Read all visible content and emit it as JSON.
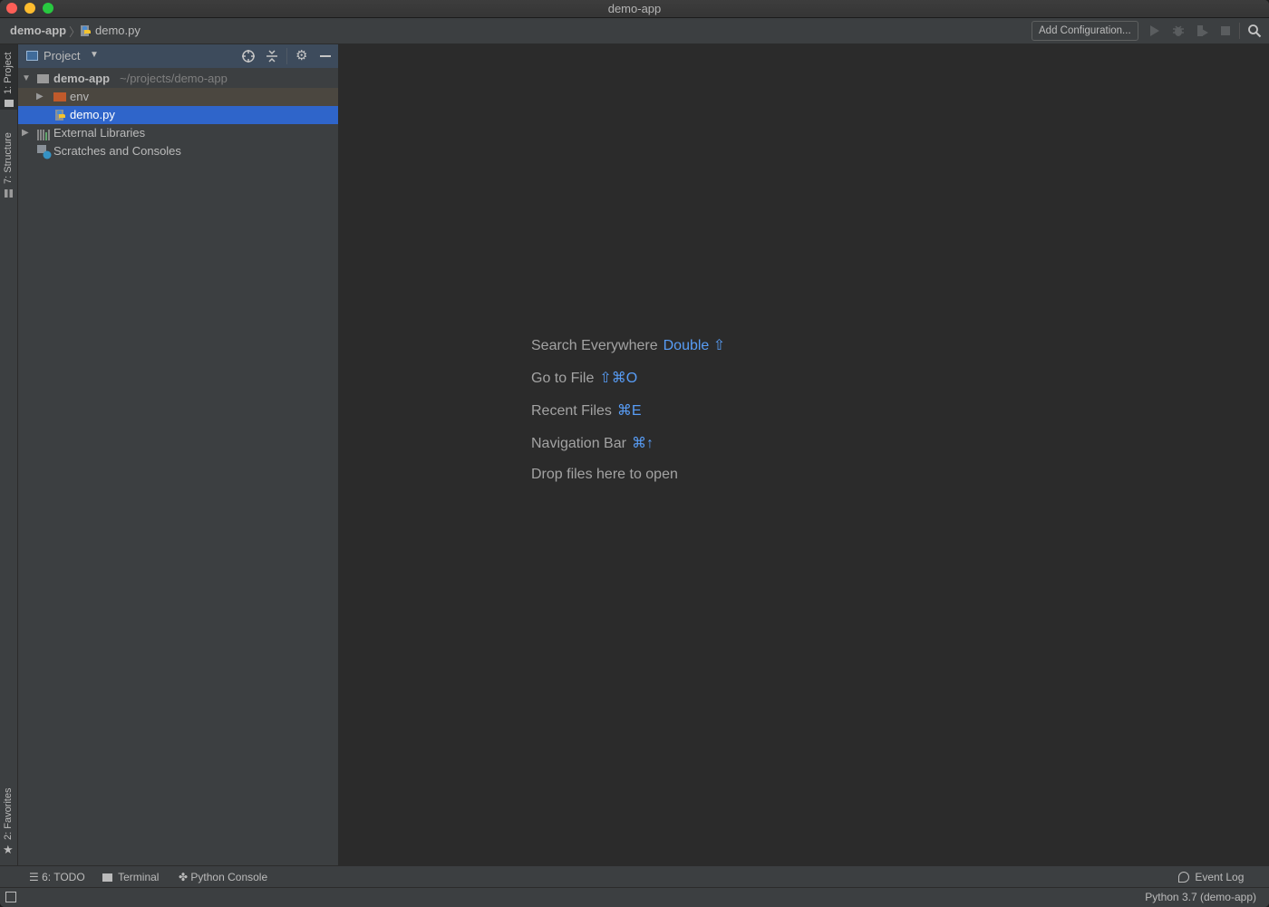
{
  "window": {
    "title": "demo-app"
  },
  "navbar": {
    "breadcrumb": [
      "demo-app",
      "demo.py"
    ],
    "add_config_label": "Add Configuration...",
    "icons": [
      "run-icon",
      "debug-icon",
      "coverage-icon",
      "stop-icon",
      "search-icon"
    ]
  },
  "left_strip": {
    "tabs": [
      "1: Project",
      "7: Structure",
      "2: Favorites"
    ]
  },
  "project_panel": {
    "title": "Project",
    "tree": [
      {
        "label": "demo-app",
        "hint": "~/projects/demo-app",
        "icon": "folder-icon",
        "expanded": true
      },
      {
        "label": "env",
        "icon": "folder-excluded-icon",
        "expanded": false
      },
      {
        "label": "demo.py",
        "icon": "python-file-icon",
        "selected": true
      },
      {
        "label": "External Libraries",
        "icon": "libraries-icon",
        "expanded": false
      },
      {
        "label": "Scratches and Consoles",
        "icon": "scratches-icon"
      }
    ]
  },
  "editor": {
    "hints": [
      {
        "label": "Search Everywhere",
        "shortcut": "Double ⇧"
      },
      {
        "label": "Go to File",
        "shortcut": "⇧⌘O"
      },
      {
        "label": "Recent Files",
        "shortcut": "⌘E"
      },
      {
        "label": "Navigation Bar",
        "shortcut": "⌘↑"
      },
      {
        "label": "Drop files here to open",
        "shortcut": ""
      }
    ],
    "accent": "#589df6"
  },
  "bottom_tools": [
    {
      "label": "6: TODO"
    },
    {
      "label": "Terminal"
    },
    {
      "label": "Python Console"
    },
    {
      "label": "Event Log"
    }
  ],
  "status": {
    "interpreter": "Python 3.7 (demo-app)"
  }
}
